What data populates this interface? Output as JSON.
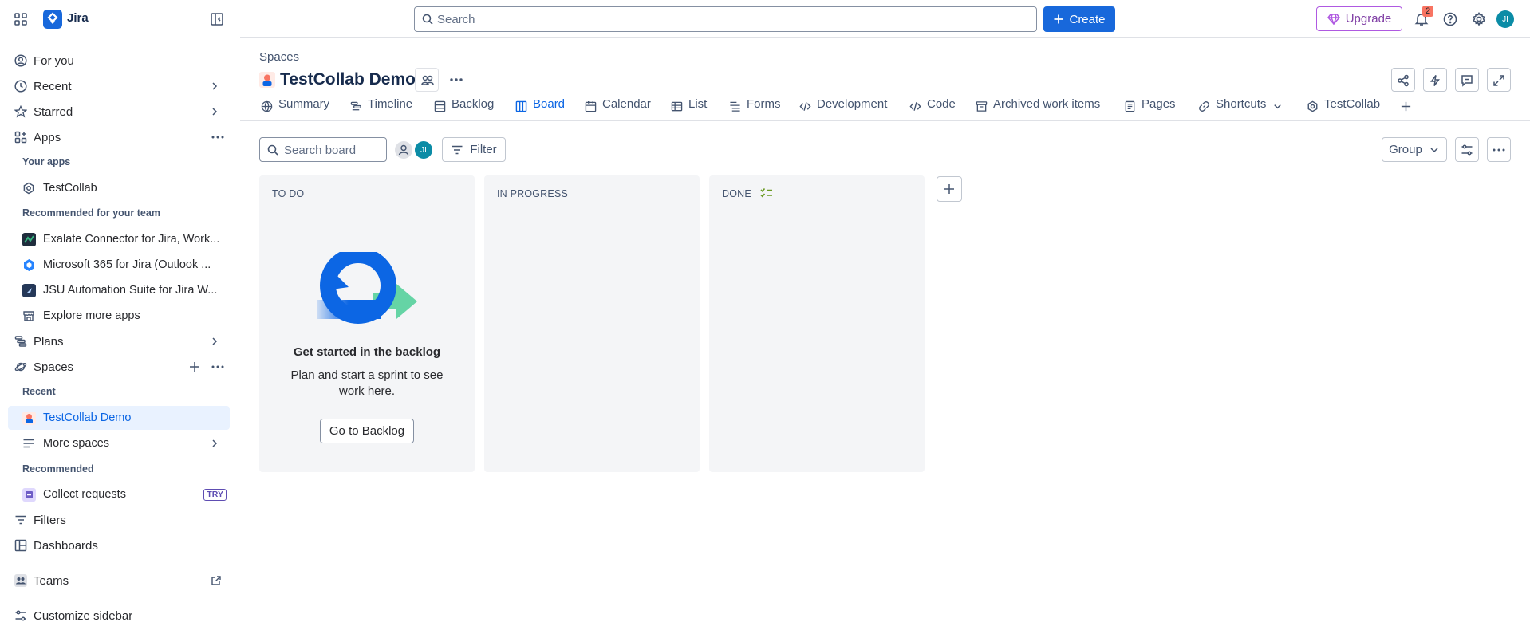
{
  "app": {
    "name": "Jira"
  },
  "sidebar": {
    "for_you": "For you",
    "recent": "Recent",
    "starred": "Starred",
    "apps": "Apps",
    "your_apps_header": "Your apps",
    "your_apps": [
      {
        "label": "TestCollab",
        "icon": "testcollab-icon"
      }
    ],
    "recommended_team_header": "Recommended for your team",
    "recommended_team": [
      {
        "label": "Exalate Connector for Jira, Work...",
        "icon": "exalate-icon",
        "color": "#1f2d3d"
      },
      {
        "label": "Microsoft 365 for Jira (Outlook ...",
        "icon": "microsoft365-icon",
        "color": "#2684ff"
      },
      {
        "label": "JSU Automation Suite for Jira W...",
        "icon": "jsu-icon",
        "color": "#253858"
      }
    ],
    "explore_apps": "Explore more apps",
    "plans": "Plans",
    "spaces": "Spaces",
    "spaces_recent_header": "Recent",
    "current_space": "TestCollab Demo",
    "more_spaces": "More spaces",
    "recommended_header": "Recommended",
    "collect_requests": "Collect requests",
    "try_badge": "TRY",
    "filters": "Filters",
    "dashboards": "Dashboards",
    "teams": "Teams",
    "customize": "Customize sidebar"
  },
  "topbar": {
    "search_placeholder": "Search",
    "create_label": "Create",
    "upgrade_label": "Upgrade",
    "notification_count": "2",
    "avatar_initials": "JI"
  },
  "space": {
    "breadcrumb": "Spaces",
    "title": "TestCollab Demo"
  },
  "tabs": [
    {
      "label": "Summary",
      "icon": "globe-icon"
    },
    {
      "label": "Timeline",
      "icon": "timeline-icon"
    },
    {
      "label": "Backlog",
      "icon": "backlog-icon"
    },
    {
      "label": "Board",
      "icon": "board-icon",
      "active": true
    },
    {
      "label": "Calendar",
      "icon": "calendar-icon"
    },
    {
      "label": "List",
      "icon": "list-icon"
    },
    {
      "label": "Forms",
      "icon": "forms-icon"
    },
    {
      "label": "Development",
      "icon": "development-icon"
    },
    {
      "label": "Code",
      "icon": "code-icon"
    },
    {
      "label": "Archived work items",
      "icon": "archive-icon"
    },
    {
      "label": "Pages",
      "icon": "pages-icon"
    },
    {
      "label": "Shortcuts",
      "icon": "link-icon"
    },
    {
      "label": "TestCollab",
      "icon": "testcollab-icon"
    }
  ],
  "board": {
    "search_placeholder": "Search board",
    "filter_label": "Filter",
    "group_label": "Group",
    "columns": [
      {
        "title": "TO DO"
      },
      {
        "title": "IN PROGRESS"
      },
      {
        "title": "DONE"
      }
    ],
    "empty_state": {
      "title": "Get started in the backlog",
      "description": "Plan and start a sprint to see work here.",
      "button": "Go to Backlog"
    }
  },
  "colors": {
    "accent": "#0c66e4",
    "create_button": "#1868db",
    "upgrade": "#803fa5",
    "done_check": "#6a9a23"
  }
}
